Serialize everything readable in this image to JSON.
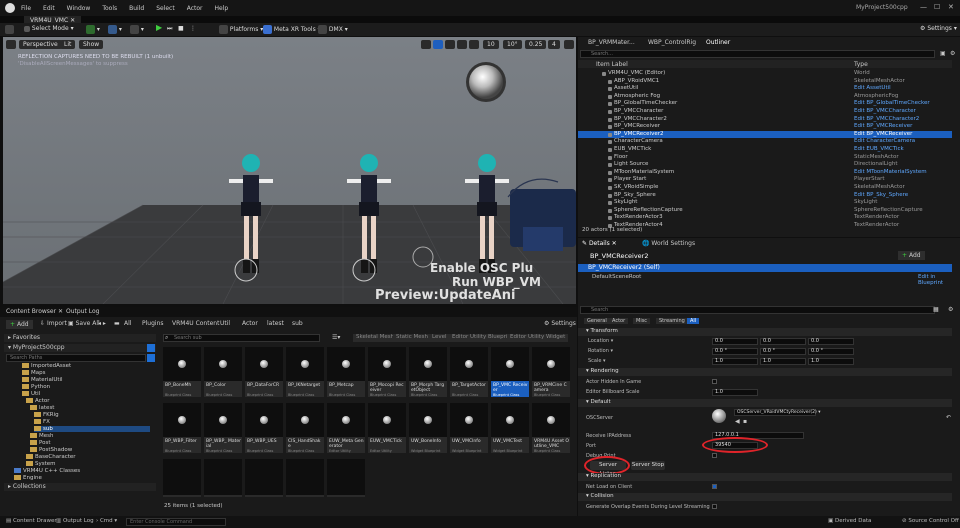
{
  "menu": {
    "file": "File",
    "edit": "Edit",
    "window": "Window",
    "tools": "Tools",
    "build": "Build",
    "select": "Select",
    "actor": "Actor",
    "help": "Help"
  },
  "project_name": "MyProject500cpp",
  "doc_tab": "VRM4U_VMC",
  "toolbar": {
    "select_mode": "Select Mode",
    "platforms": "Platforms",
    "meta_xr": "Meta XR Tools",
    "dmx": "DMX",
    "settings": "Settings"
  },
  "viewport": {
    "perspective": "Perspective",
    "lit": "Lit",
    "show": "Show",
    "warn1": "REFLECTION CAPTURES NEED TO BE REBUILT (1 unbuilt)",
    "warn2": "'DisableAllScreenMessages' to suppress",
    "grid": "10",
    "angle": "10°",
    "scale": "0.25",
    "cam": "4",
    "overlay1": "Enable OSC Plu",
    "overlay2": "Run WBP_VM",
    "overlay3": "Preview:UpdateAni"
  },
  "cb": {
    "tab1": "Content Browser",
    "tab2": "Output Log",
    "add": "Add",
    "import": "Import",
    "save_all": "Save All",
    "settings": "Settings",
    "path": [
      "All",
      "Plugins",
      "VRM4U Content",
      "Util",
      "Actor",
      "latest",
      "sub"
    ],
    "search_placeholder": "Search sub",
    "search_paths": "Search Paths",
    "filters": [
      "Skeletal Mesh",
      "Static Mesh",
      "Level",
      "Editor Utility Blueprint",
      "Editor Utility Widget"
    ],
    "favorites": "Favorites",
    "project": "MyProject500cpp",
    "collections": "Collections",
    "tree": [
      "ImportedAsset",
      "Maps",
      "MaterialUtil",
      "Python",
      "Util",
      "Actor",
      "latest",
      "FKRig",
      "FX",
      "sub",
      "Mesh",
      "Post",
      "PostShadow",
      "BaseCharacter",
      "System",
      "VRM4U C++ Classes",
      "Engine"
    ],
    "items_row1": [
      {
        "name": "BP_BoneMh",
        "kind": "Blueprint Class"
      },
      {
        "name": "BP_Color",
        "kind": "Blueprint Class"
      },
      {
        "name": "BP_DataForCR",
        "kind": "Blueprint Class"
      },
      {
        "name": "BP_IKNetarget",
        "kind": "Blueprint Class"
      },
      {
        "name": "BP_Metcap",
        "kind": "Blueprint Class"
      },
      {
        "name": "BP_Mocopi Receiver",
        "kind": "Blueprint Class"
      },
      {
        "name": "BP_Morph TargetObject",
        "kind": "Blueprint Class"
      },
      {
        "name": "BP_TargetActor",
        "kind": "Blueprint Class"
      },
      {
        "name": "BP_VMC Receiver",
        "kind": "Blueprint Class"
      },
      {
        "name": "BP_VRMCine Camera",
        "kind": "Blueprint Class"
      }
    ],
    "items_row2": [
      {
        "name": "BP_WBP_Filter",
        "kind": "Blueprint Class"
      },
      {
        "name": "BP_WBP_ Material",
        "kind": "Blueprint Class"
      },
      {
        "name": "BP_WBP_UES",
        "kind": "Blueprint Class"
      },
      {
        "name": "CIS_HandShake",
        "kind": "Blueprint Class"
      },
      {
        "name": "EUW_Meta Generator",
        "kind": "Editor Utility"
      },
      {
        "name": "EUW_VMCTick",
        "kind": "Editor Utility"
      },
      {
        "name": "UW_BoneInfo",
        "kind": "Widget Blueprint"
      },
      {
        "name": "UW_VMCInfo",
        "kind": "Widget Blueprint"
      },
      {
        "name": "UW_VMCTest",
        "kind": "Widget Blueprint"
      },
      {
        "name": "VRM4U Asset Outline_VMC",
        "kind": "Blueprint Class"
      }
    ],
    "status": "25 items (1 selected)"
  },
  "outliner": {
    "tabs": [
      "BP_VRMMater...",
      "WBP_ControlRig",
      "Outliner"
    ],
    "search_placeholder": "Search...",
    "col_label": "Item Label",
    "col_type": "Type",
    "rows": [
      {
        "label": "VRM4U_VMC (Editor)",
        "type": "World",
        "link": false,
        "sel": false
      },
      {
        "label": "ABP_VRoidVMC1",
        "type": "SkeletalMeshActor",
        "link": false,
        "sel": false
      },
      {
        "label": "AssetUtil",
        "type": "Edit AssetUtil",
        "link": true,
        "sel": false
      },
      {
        "label": "Atmospheric Fog",
        "type": "AtmosphericFog",
        "link": false,
        "sel": false
      },
      {
        "label": "BP_GlobalTimeChecker",
        "type": "Edit BP_GlobalTimeChecker",
        "link": true,
        "sel": false
      },
      {
        "label": "BP_VMCCharacter",
        "type": "Edit BP_VMCCharacter",
        "link": true,
        "sel": false
      },
      {
        "label": "BP_VMCCharacter2",
        "type": "Edit BP_VMCCharacter2",
        "link": true,
        "sel": false
      },
      {
        "label": "BP_VMCReceiver",
        "type": "Edit BP_VMCReceiver",
        "link": true,
        "sel": false
      },
      {
        "label": "BP_VMCReceiver2",
        "type": "Edit BP_VMCReceiver",
        "link": true,
        "sel": true
      },
      {
        "label": "CharacterCamera",
        "type": "Edit CharacterCamera",
        "link": true,
        "sel": false
      },
      {
        "label": "EUB_VMCTick",
        "type": "Edit EUB_VMCTick",
        "link": true,
        "sel": false
      },
      {
        "label": "Floor",
        "type": "StaticMeshActor",
        "link": false,
        "sel": false
      },
      {
        "label": "Light Source",
        "type": "DirectionalLight",
        "link": false,
        "sel": false
      },
      {
        "label": "MToonMaterialSystem",
        "type": "Edit MToonMaterialSystem",
        "link": true,
        "sel": false
      },
      {
        "label": "Player Start",
        "type": "PlayerStart",
        "link": false,
        "sel": false
      },
      {
        "label": "SK_VRoidSimple",
        "type": "SkeletalMeshActor",
        "link": false,
        "sel": false
      },
      {
        "label": "BP_Sky_Sphere",
        "type": "Edit BP_Sky_Sphere",
        "link": true,
        "sel": false
      },
      {
        "label": "SkyLight",
        "type": "SkyLight",
        "link": false,
        "sel": false
      },
      {
        "label": "SphereReflectionCapture",
        "type": "SphereReflectionCapture",
        "link": false,
        "sel": false
      },
      {
        "label": "TextRenderActor3",
        "type": "TextRenderActor",
        "link": false,
        "sel": false
      },
      {
        "label": "TextRenderActor4",
        "type": "TextRenderActor",
        "link": false,
        "sel": false
      }
    ],
    "count": "20 actors (1 selected)"
  },
  "details": {
    "tab1": "Details",
    "tab2": "World Settings",
    "actor": "BP_VMCReceiver2",
    "add": "Add",
    "self": "BP_VMCReceiver2 (Self)",
    "root": "DefaultSceneRoot",
    "edit_bp": "Edit in Blueprint",
    "search_placeholder": "Search",
    "filter_tabs": [
      "General",
      "Actor",
      "Misc",
      "Streaming",
      "All"
    ],
    "transform": "Transform",
    "location": "Location",
    "rotation": "Rotation",
    "scale": "Scale",
    "loc": [
      "0.0",
      "0.0",
      "0.0"
    ],
    "rot": [
      "0.0 °",
      "0.0 °",
      "0.0 °"
    ],
    "scl": [
      "1.0",
      "1.0",
      "1.0"
    ],
    "rendering": "Rendering",
    "hidden": "Actor Hidden In Game",
    "billboard": "Editor Billboard Scale",
    "billboard_val": "1.0",
    "default": "Default",
    "oscserver": "OSCServer",
    "oscserver_val": "OSCServer_VRoidVMCtyReceiver(2)",
    "ip_label": "Receive IPAddress",
    "ip": "127.0.0.1",
    "port_label": "Port",
    "port": "39540",
    "debug": "Debug Print",
    "listen": "Server Listen",
    "stop": "Server Stop",
    "replication": "Replication",
    "netload": "Net Load on Client",
    "collision": "Collision",
    "overlap": "Generate Overlap Events During Level Streaming"
  },
  "statusbar": {
    "drawer": "Content Drawer",
    "output": "Output Log",
    "cmd": "Cmd",
    "console_placeholder": "Enter Console Command",
    "derived": "Derived Data",
    "source": "Source Control Off"
  }
}
